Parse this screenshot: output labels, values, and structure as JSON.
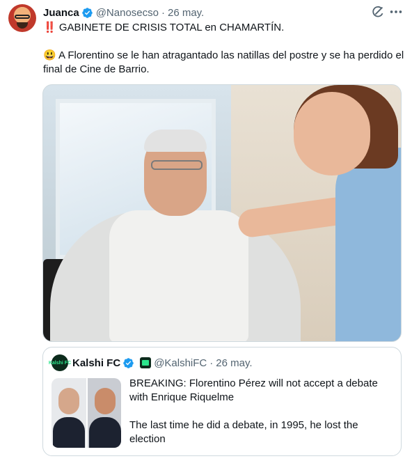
{
  "tweet": {
    "author": {
      "display_name": "Juanca",
      "handle": "@Nanosecso",
      "separator": "·",
      "time": "26 may."
    },
    "icons": {
      "verified": "verified-badge-icon",
      "grok": "grok-icon",
      "more": "more-options-icon"
    },
    "text": {
      "line1": "‼️ GABINETE DE CRISIS TOTAL en CHAMARTÍN.",
      "line2": "😃 A Florentino se le han atragantado las natillas del postre y se ha perdido el final de Cine de Barrio."
    },
    "colors": {
      "verified": "#1d9bf0",
      "secondary_text": "#536471",
      "border": "#cfd9de"
    }
  },
  "quote": {
    "author": {
      "display_name": "Kalshi FC",
      "avatar_text": "Kalshi FC",
      "handle": "@KalshiFC",
      "separator": "·",
      "time": "26 may."
    },
    "text": {
      "para1": "BREAKING: Florentino Pérez will not accept a debate with Enrique Riquelme",
      "para2": "The last time he did a debate, in 1995, he lost the election"
    },
    "colors": {
      "brand": "#2be68c",
      "brand_dark": "#0c2b1c"
    }
  }
}
